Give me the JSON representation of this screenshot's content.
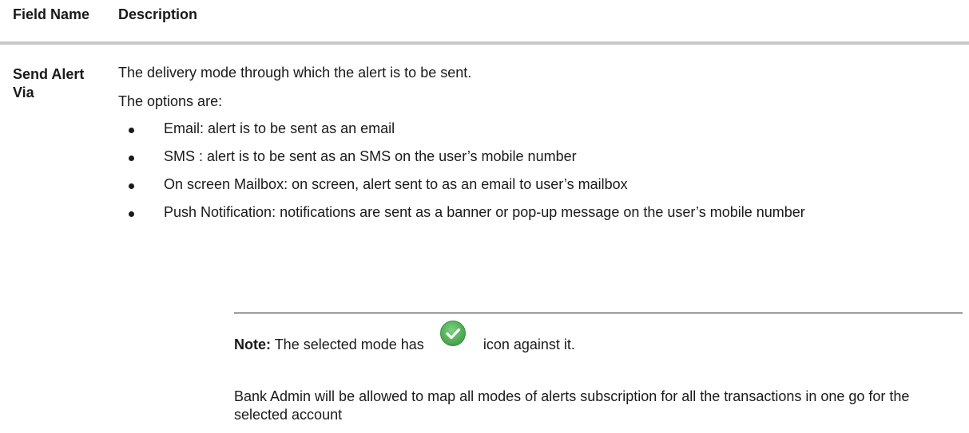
{
  "table": {
    "headers": {
      "field_name": "Field Name",
      "description": "Description"
    },
    "row": {
      "field_name": "Send Alert Via",
      "description_line1": "The delivery mode through which the alert is to be sent.",
      "description_line2": "The options are:",
      "options": [
        "Email: alert is to be sent as an email",
        "SMS : alert is to be sent as an SMS on the user’s mobile number",
        "On screen Mailbox: on screen, alert sent to as an email to user’s mailbox",
        "Push Notification: notifications are sent as a banner or pop-up message on the user’s mobile number"
      ],
      "note": {
        "label": "Note:",
        "text_before_icon": "The selected mode has",
        "icon": "check-circle-icon",
        "icon_color": "#4caf50",
        "text_after_icon": "icon against it."
      },
      "admin_text": "Bank Admin will be allowed to map all modes of alerts subscription for all the transactions in one go for the selected account"
    }
  }
}
